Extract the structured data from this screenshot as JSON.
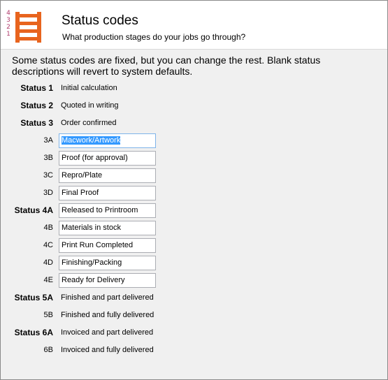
{
  "header": {
    "title": "Status codes",
    "subtitle": "What production stages do your jobs go through?",
    "icon_numbers": [
      "4",
      "3",
      "2",
      "1"
    ]
  },
  "intro": "Some status codes are fixed, but you can change the rest. Blank status descriptions will revert to system defaults.",
  "rows": [
    {
      "label": "Status 1",
      "bold": true,
      "value": "Initial calculation",
      "editable": false
    },
    {
      "label": "Status 2",
      "bold": true,
      "value": "Quoted in writing",
      "editable": false
    },
    {
      "label": "Status 3",
      "bold": true,
      "value": "Order confirmed",
      "editable": false
    },
    {
      "label": "3A",
      "bold": false,
      "value": "Macwork/Artwork",
      "editable": true,
      "selected": true
    },
    {
      "label": "3B",
      "bold": false,
      "value": "Proof (for approval)",
      "editable": true
    },
    {
      "label": "3C",
      "bold": false,
      "value": "Repro/Plate",
      "editable": true
    },
    {
      "label": "3D",
      "bold": false,
      "value": "Final Proof",
      "editable": true
    },
    {
      "label": "Status 4A",
      "bold": true,
      "value": "Released to Printroom",
      "editable": true
    },
    {
      "label": "4B",
      "bold": false,
      "value": "Materials in stock",
      "editable": true
    },
    {
      "label": "4C",
      "bold": false,
      "value": "Print Run Completed",
      "editable": true
    },
    {
      "label": "4D",
      "bold": false,
      "value": "Finishing/Packing",
      "editable": true
    },
    {
      "label": "4E",
      "bold": false,
      "value": "Ready for Delivery",
      "editable": true
    },
    {
      "label": "Status 5A",
      "bold": true,
      "value": "Finished and part delivered",
      "editable": false
    },
    {
      "label": "5B",
      "bold": false,
      "value": "Finished and fully delivered",
      "editable": false
    },
    {
      "label": "Status 6A",
      "bold": true,
      "value": "Invoiced and part delivered",
      "editable": false
    },
    {
      "label": "6B",
      "bold": false,
      "value": "Invoiced and fully delivered",
      "editable": false
    }
  ],
  "colors": {
    "accent_orange": "#e8641e",
    "number_pink": "#b03a6a",
    "selection": "#3399ff"
  },
  "icons": {
    "header_icon": "ladder-icon"
  }
}
